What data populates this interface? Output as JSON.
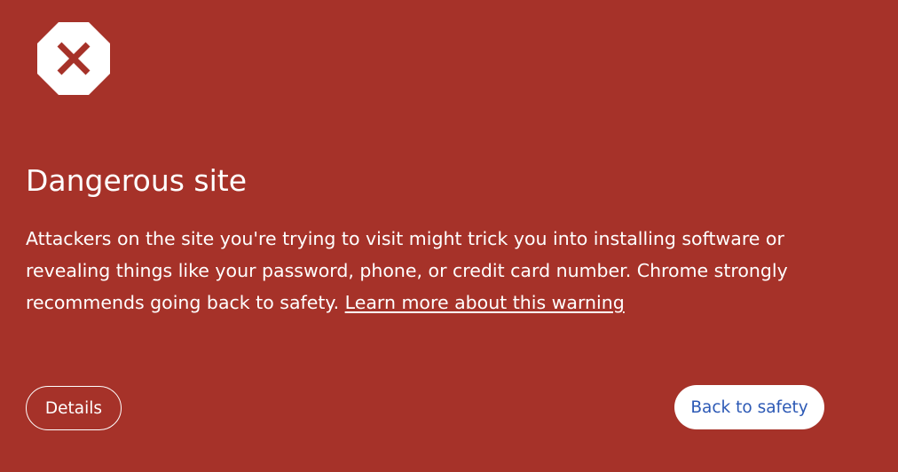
{
  "page": {
    "background_color": "#a63229",
    "icon": "danger-octagon-x-icon",
    "title": "Dangerous site",
    "body_text": "Attackers on the site you're trying to visit might trick you into installing software or revealing things like your password, phone, or credit card number. Chrome strongly recommends going back to safety.",
    "learn_more_link": "Learn more about this warning"
  },
  "buttons": {
    "details_label": "Details",
    "back_label": "Back to safety",
    "back_text_color": "#2c59b5"
  }
}
